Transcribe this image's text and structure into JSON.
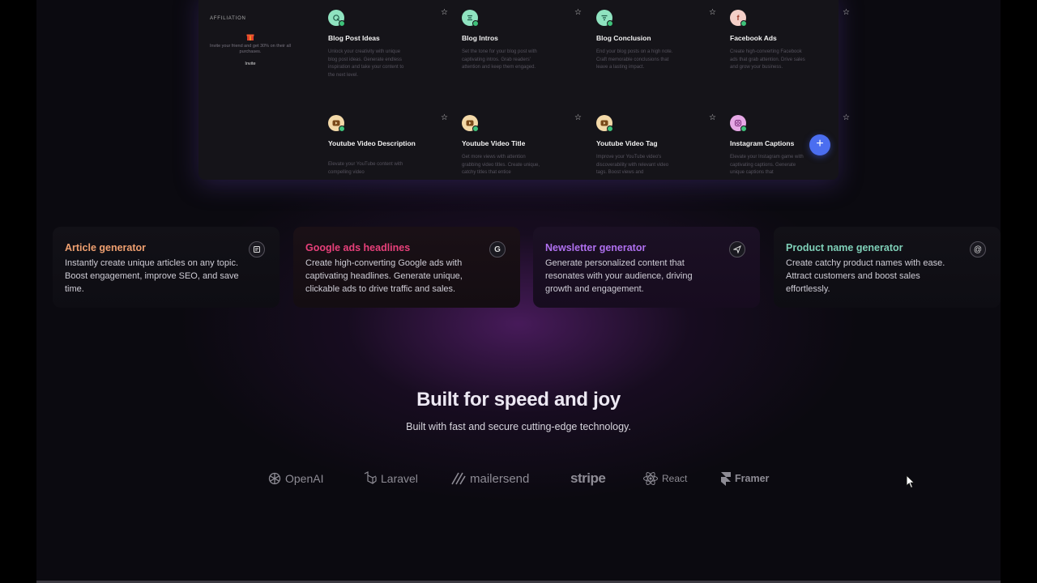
{
  "affiliation": {
    "title": "AFFILIATION",
    "text": "Invite your friend and get 30% on their all purchases.",
    "invite_label": "Invite"
  },
  "tools": [
    {
      "title": "Blog Post Ideas",
      "desc": "Unlock your creativity with unique blog post ideas. Generate endless inspiration and take your content to the next level.",
      "icon": "edit-sparkle-icon",
      "color": "#8fe3c0"
    },
    {
      "title": "Blog Intros",
      "desc": "Set the tone for your blog post with captivating intros. Grab readers' attention and keep them engaged.",
      "icon": "align-center-icon",
      "color": "#8fe3c0"
    },
    {
      "title": "Blog Conclusion",
      "desc": "End your blog posts on a high note. Craft memorable conclusions that leave a lasting impact.",
      "icon": "filter-icon",
      "color": "#8fe3c0"
    },
    {
      "title": "Facebook Ads",
      "desc": "Create high-converting Facebook ads that grab attention. Drive sales and grow your business.",
      "icon": "facebook-icon",
      "color": "#f4cfc8"
    },
    {
      "title": "Youtube Video Description",
      "desc": "Elevate your YouTube content with compelling video",
      "icon": "youtube-icon",
      "color": "#f3d9a8"
    },
    {
      "title": "Youtube Video Title",
      "desc": "Get more views with attention grabbing video titles. Create unique, catchy titles that entice",
      "icon": "youtube-icon",
      "color": "#f3d9a8"
    },
    {
      "title": "Youtube Video Tag",
      "desc": "Improve your YouTube video's discoverability with relevant video tags. Boost views and",
      "icon": "youtube-icon",
      "color": "#f3d9a8"
    },
    {
      "title": "Instagram Captions",
      "desc": "Elevate your Instagram game with captivating captions. Generate unique captions that",
      "icon": "instagram-icon",
      "color": "#e6a8e6"
    }
  ],
  "fab_label": "+",
  "star_glyph": "☆",
  "cards": [
    {
      "title": "Article generator",
      "desc": "Instantly create unique articles on any topic. Boost engagement, improve SEO, and save time.",
      "color": "#f0a070",
      "icon": "document-icon"
    },
    {
      "title": "Google ads headlines",
      "desc": "Create high-converting Google ads with captivating headlines. Generate unique, clickable ads to drive traffic and sales.",
      "color": "#e8407a",
      "icon": "google-icon"
    },
    {
      "title": "Newsletter generator",
      "desc": "Generate personalized content that resonates with your audience, driving growth and engagement.",
      "color": "#b070f0",
      "icon": "send-icon"
    },
    {
      "title": "Product name generator",
      "desc": "Create catchy product names with ease. Attract customers and boost sales effortlessly.",
      "color": "#7fd0b8",
      "icon": "at-sign-icon"
    }
  ],
  "headline": "Built for speed and joy",
  "subline": "Built with fast and secure cutting-edge technology.",
  "logos": [
    {
      "name": "OpenAI",
      "icon": "openai-icon"
    },
    {
      "name": "Laravel",
      "icon": "laravel-icon"
    },
    {
      "name": "mailersend",
      "icon": "mailersend-icon"
    },
    {
      "name": "stripe",
      "icon": ""
    },
    {
      "name": "React",
      "icon": "react-icon"
    },
    {
      "name": "Framer",
      "icon": "framer-icon"
    }
  ]
}
